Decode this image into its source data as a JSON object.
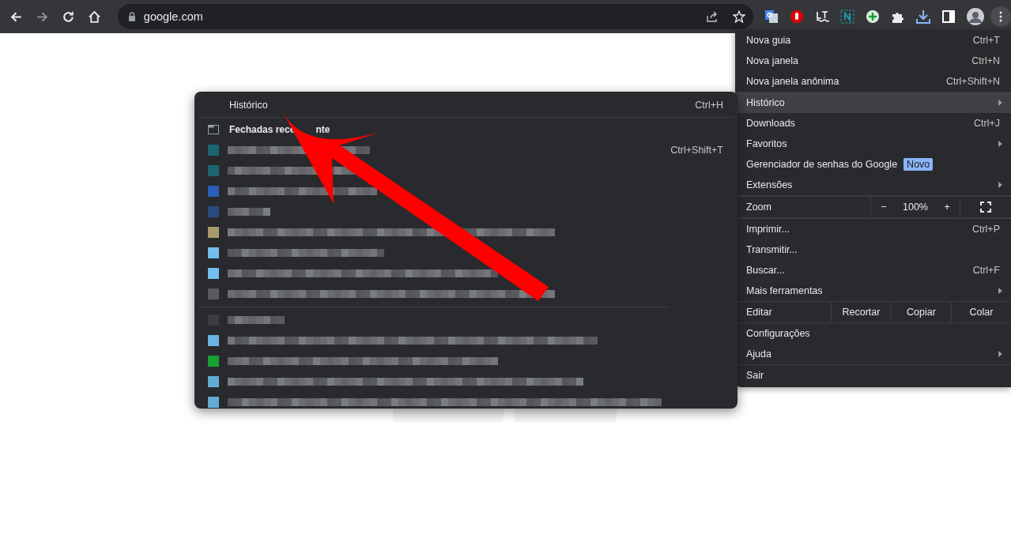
{
  "toolbar": {
    "nav": [
      {
        "kind": "back",
        "disabled": false
      },
      {
        "kind": "forward",
        "disabled": true
      },
      {
        "kind": "reload",
        "disabled": false
      },
      {
        "kind": "home",
        "disabled": false
      }
    ],
    "address": "google.com",
    "omnibox_actions": [
      {
        "kind": "share"
      },
      {
        "kind": "star"
      }
    ],
    "extensions": [
      {
        "kind": "translate"
      },
      {
        "kind": "stop-hand"
      },
      {
        "kind": "lt"
      },
      {
        "kind": "n-box"
      },
      {
        "kind": "plus"
      },
      {
        "kind": "puzzle"
      },
      {
        "kind": "download"
      },
      {
        "kind": "side-panel"
      },
      {
        "kind": "avatar"
      },
      {
        "kind": "kebab"
      }
    ]
  },
  "menu": {
    "items": [
      {
        "kind": "item",
        "label": "Nova guia",
        "shortcut": "Ctrl+T",
        "submenu": false,
        "selected": false
      },
      {
        "kind": "item",
        "label": "Nova janela",
        "shortcut": "Ctrl+N",
        "submenu": false,
        "selected": false
      },
      {
        "kind": "item",
        "label": "Nova janela anônima",
        "shortcut": "Ctrl+Shift+N",
        "submenu": false,
        "selected": false
      },
      {
        "kind": "separator"
      },
      {
        "kind": "item",
        "label": "Histórico",
        "submenu": true,
        "selected": true
      },
      {
        "kind": "item",
        "label": "Downloads",
        "shortcut": "Ctrl+J",
        "submenu": false,
        "selected": false
      },
      {
        "kind": "item",
        "label": "Favoritos",
        "submenu": true,
        "selected": false
      },
      {
        "kind": "item",
        "label": "Gerenciador de senhas do Google",
        "badge": "Novo",
        "submenu": false,
        "selected": false
      },
      {
        "kind": "item",
        "label": "Extensões",
        "submenu": true,
        "selected": false
      },
      {
        "kind": "separator"
      },
      {
        "kind": "zoom",
        "label": "Zoom",
        "minus": "−",
        "value": "100%",
        "plus": "+"
      },
      {
        "kind": "separator"
      },
      {
        "kind": "item",
        "label": "Imprimir...",
        "shortcut": "Ctrl+P",
        "submenu": false,
        "selected": false
      },
      {
        "kind": "item",
        "label": "Transmitir...",
        "submenu": false,
        "selected": false
      },
      {
        "kind": "item",
        "label": "Buscar...",
        "shortcut": "Ctrl+F",
        "submenu": false,
        "selected": false
      },
      {
        "kind": "item",
        "label": "Mais ferramentas",
        "submenu": true,
        "selected": false
      },
      {
        "kind": "separator"
      },
      {
        "kind": "edit",
        "label": "Editar",
        "actions": [
          "Recortar",
          "Copiar",
          "Colar"
        ]
      },
      {
        "kind": "separator"
      },
      {
        "kind": "item",
        "label": "Configurações",
        "submenu": false,
        "selected": false
      },
      {
        "kind": "item",
        "label": "Ajuda",
        "submenu": true,
        "selected": false
      },
      {
        "kind": "separator"
      },
      {
        "kind": "item",
        "label": "Sair",
        "submenu": false,
        "selected": false
      }
    ]
  },
  "submenu": {
    "header": {
      "label": "Histórico",
      "shortcut": "Ctrl+H"
    },
    "section": [
      "Fechadas rece",
      "nte"
    ],
    "groups": [
      {
        "entries": [
          {
            "color": "#1b6470",
            "shortcut": "Ctrl+Shift+T"
          },
          {
            "color": "#1b6470"
          },
          {
            "color": "#2a5fb5"
          },
          {
            "color": "#284a80"
          },
          {
            "color": "#a89a6a"
          },
          {
            "color": "#74bdec"
          },
          {
            "color": "#74bdec"
          },
          {
            "color": "#5a5b5e"
          }
        ]
      },
      {
        "entries": [
          {
            "color": "#3c3d40"
          },
          {
            "color": "#6ab2e4"
          },
          {
            "color": "#18a032"
          },
          {
            "color": "#62acd4"
          },
          {
            "color": "#62acd4"
          }
        ]
      }
    ]
  }
}
